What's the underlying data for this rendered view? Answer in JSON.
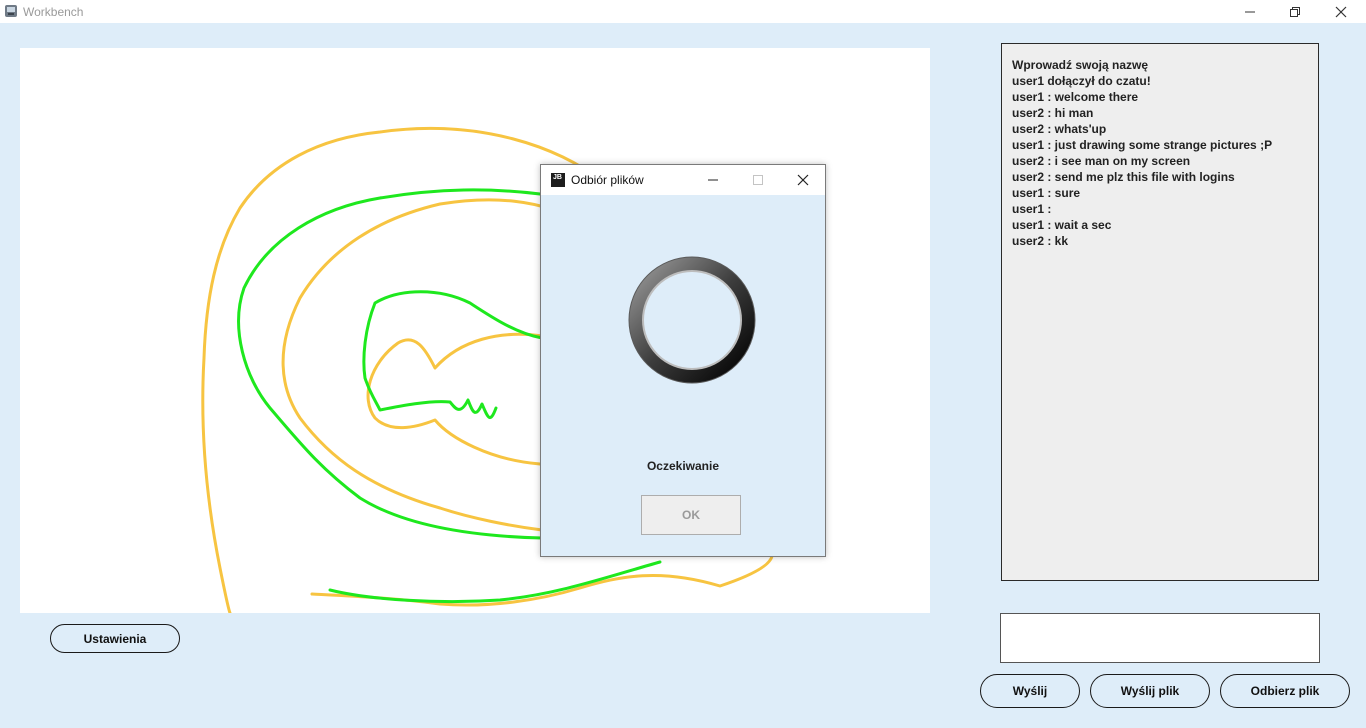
{
  "window": {
    "title": "Workbench",
    "icon": "app-icon"
  },
  "canvas": {
    "stroke_colors": {
      "yellow": "#f7c441",
      "green": "#1ee81e"
    }
  },
  "left_controls": {
    "settings_label": "Ustawienia"
  },
  "chat": {
    "lines": [
      "Wprowadź swoją nazwę",
      "user1 dołączył do czatu!",
      "user1 : welcome there",
      "user2 : hi man",
      "user2 : whats'up",
      "user1 : just drawing some strange pictures ;P",
      "user2 : i see man on my screen",
      "user2 : send me plz this file with logins",
      "user1 : sure",
      "user1 :",
      "user1 : wait a sec",
      "user2 : kk"
    ]
  },
  "message_input": {
    "value": ""
  },
  "bottom_buttons": {
    "send_label": "Wyślij",
    "send_file_label": "Wyślij plik",
    "receive_file_label": "Odbierz plik"
  },
  "dialog": {
    "icon_text": "JB",
    "title": "Odbiór plików",
    "status": "Oczekiwanie",
    "ok_label": "OK"
  }
}
